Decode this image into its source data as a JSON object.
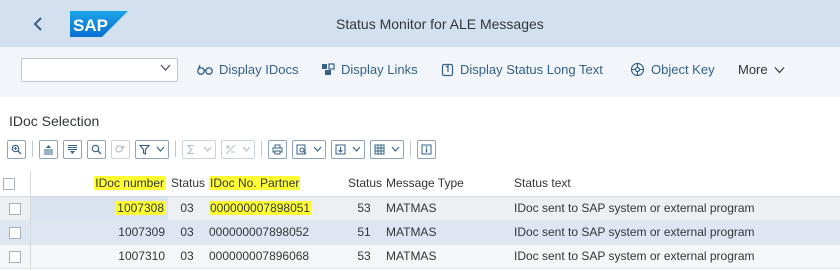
{
  "shell": {
    "back_label": "‹",
    "logo_text": "SAP",
    "title": "Status Monitor for ALE Messages"
  },
  "toolbar": {
    "combo_value": "",
    "buttons": [
      {
        "icon": "glasses-icon",
        "glyph": "6ổ",
        "label": "Display IDocs"
      },
      {
        "icon": "links-icon",
        "glyph": "⛓",
        "label": "Display Links"
      },
      {
        "icon": "long-text-icon",
        "glyph": "⎘",
        "label": "Display Status Long Text"
      },
      {
        "icon": "object-key-icon",
        "glyph": "⊛",
        "label": "Object Key"
      },
      {
        "icon": "more-icon",
        "glyph": "",
        "label": "More"
      }
    ]
  },
  "section": {
    "title": "IDoc Selection"
  },
  "table": {
    "columns": [
      "IDoc number",
      "Status",
      "IDoc No. Partner",
      "Status",
      "Message Type",
      "Status text"
    ],
    "rows": [
      [
        "1007308",
        "03",
        "000000007898051",
        "53",
        "MATMAS",
        "IDoc sent to SAP system or external program"
      ],
      [
        "1007309",
        "03",
        "000000007898052",
        "51",
        "MATMAS",
        "IDoc sent to SAP system or external program"
      ],
      [
        "1007310",
        "03",
        "000000007896068",
        "53",
        "MATMAS",
        "IDoc sent to SAP system or external program"
      ]
    ]
  },
  "colors": {
    "shell_bg": "#d3e0ef",
    "accent": "#346187",
    "highlight": "#ffff33"
  }
}
